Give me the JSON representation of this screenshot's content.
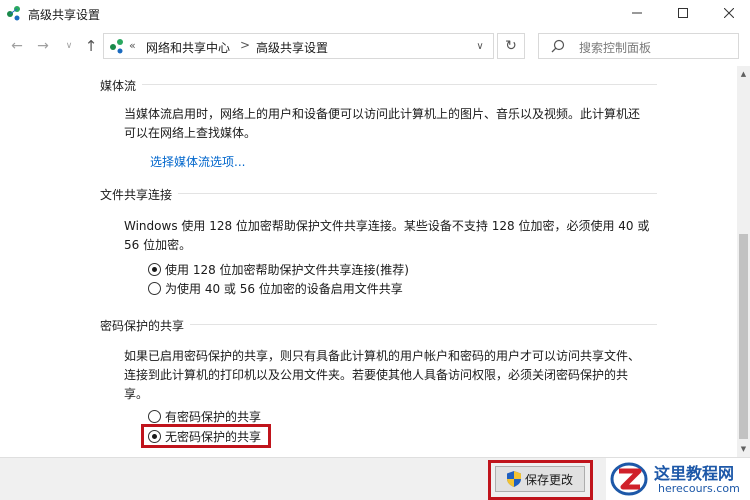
{
  "window": {
    "title": "高级共享设置",
    "minimize_icon": "minimize-icon",
    "maximize_icon": "maximize-icon",
    "close_icon": "close-icon"
  },
  "nav": {
    "back_icon": "arrow-left-icon",
    "forward_icon": "arrow-right-icon",
    "recent_icon": "chevron-down-icon",
    "up_icon": "arrow-up-icon",
    "breadcrumb_prefix": "«",
    "breadcrumb": [
      "网络和共享中心",
      "高级共享设置"
    ],
    "breadcrumb_separator": ">",
    "refresh_icon": "refresh-icon",
    "search_placeholder": "搜索控制面板"
  },
  "sections": {
    "media": {
      "title": "媒体流",
      "description": [
        "当媒体流启用时，网络上的用户和设备便可以访问此计算机上的图片、音乐以及视频。此计算机还",
        "可以在网络上查找媒体。"
      ],
      "link": "选择媒体流选项..."
    },
    "file_sharing": {
      "title": "文件共享连接",
      "description": [
        "Windows 使用 128 位加密帮助保护文件共享连接。某些设备不支持 128 位加密，必须使用 40 或",
        "56 位加密。"
      ],
      "options": [
        {
          "label": "使用 128 位加密帮助保护文件共享连接(推荐)",
          "checked": true
        },
        {
          "label": "为使用 40 或 56 位加密的设备启用文件共享",
          "checked": false
        }
      ]
    },
    "password": {
      "title": "密码保护的共享",
      "description": [
        "如果已启用密码保护的共享，则只有具备此计算机的用户帐户和密码的用户才可以访问共享文件、",
        "连接到此计算机的打印机以及公用文件夹。若要使其他人具备访问权限，必须关闭密码保护的共",
        "享。"
      ],
      "options": [
        {
          "label": "有密码保护的共享",
          "checked": false
        },
        {
          "label": "无密码保护的共享",
          "checked": true
        }
      ]
    }
  },
  "footer": {
    "save_label": "保存更改",
    "save_icon": "shield-icon"
  },
  "watermark": {
    "name": "这里教程网",
    "url": "herecours.com"
  },
  "colors": {
    "link": "#0066cc",
    "highlight": "#c0141c",
    "watermark": "#1d58a8"
  }
}
